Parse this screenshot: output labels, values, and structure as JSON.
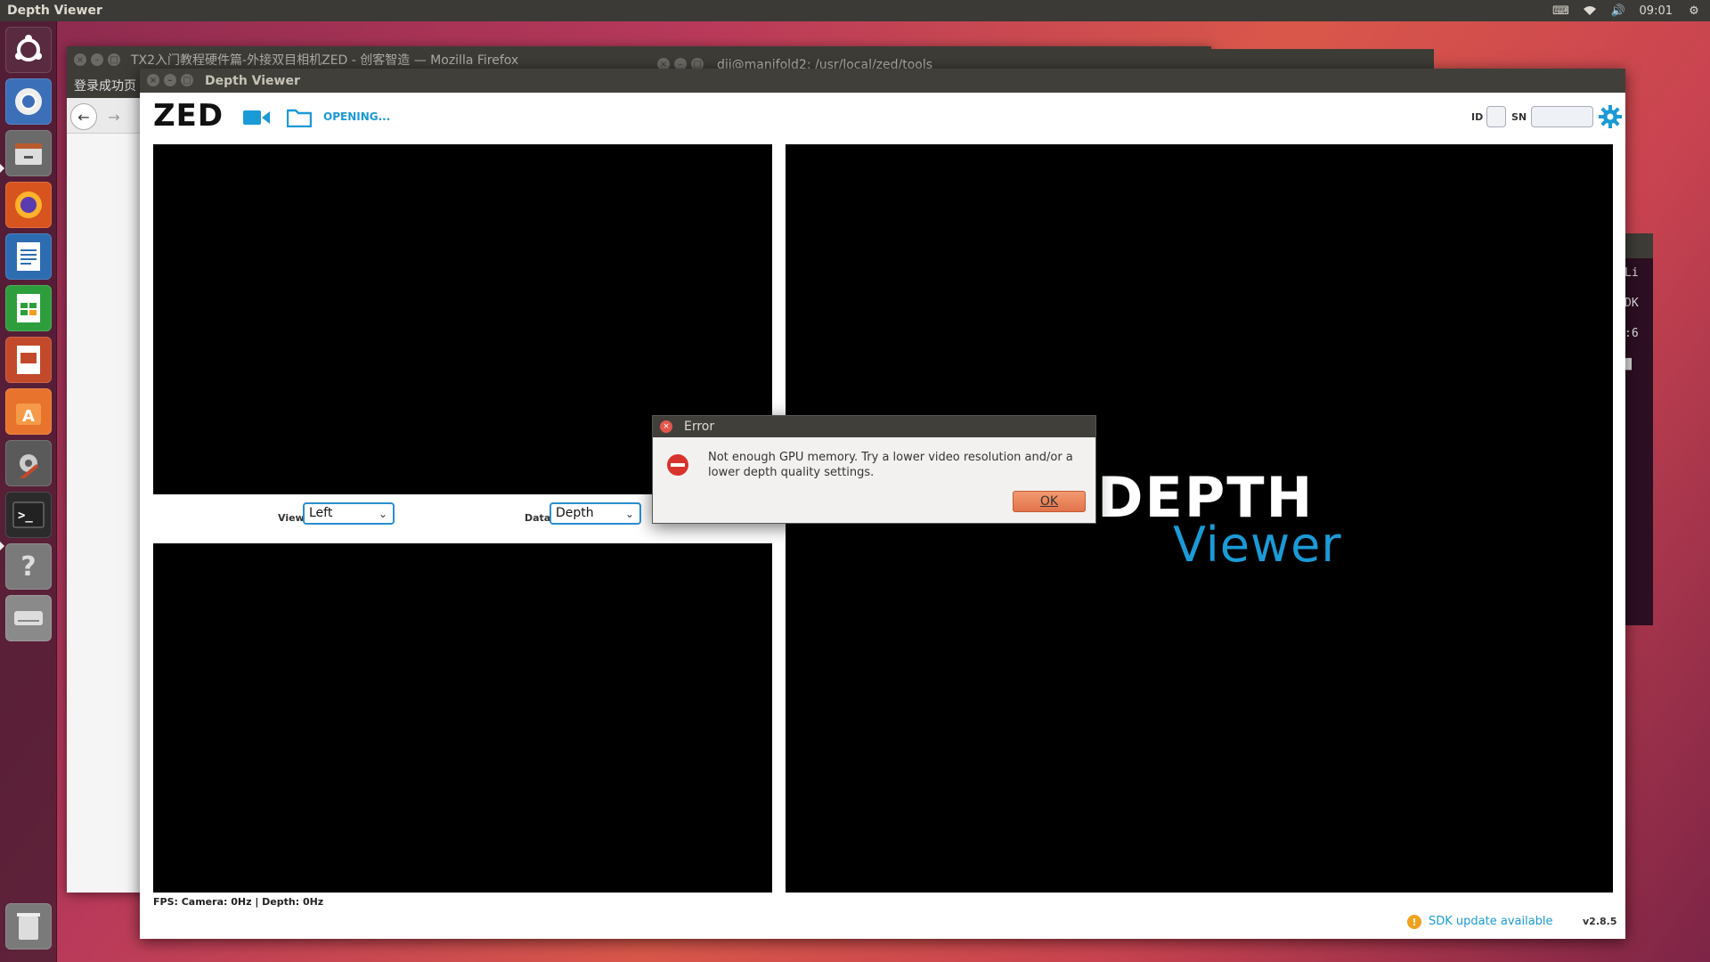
{
  "top_panel": {
    "app_title": "Depth Viewer",
    "clock": "09:01"
  },
  "launcher": {
    "items": [
      {
        "name": "ubuntu-logo",
        "color": "#5a2a40"
      },
      {
        "name": "chromium",
        "color": "#3b6fb8"
      },
      {
        "name": "files",
        "color": "#6a6a6a"
      },
      {
        "name": "firefox",
        "color": "#d7541e"
      },
      {
        "name": "writer",
        "color": "#2d6cb1"
      },
      {
        "name": "calc",
        "color": "#2e9e3d"
      },
      {
        "name": "impress",
        "color": "#c24a2a"
      },
      {
        "name": "software-center",
        "color": "#e8732c"
      },
      {
        "name": "settings",
        "color": "#5a5a5a"
      },
      {
        "name": "terminal",
        "color": "#2b2b2b"
      },
      {
        "name": "help",
        "color": "#7a7a7a"
      },
      {
        "name": "disk",
        "color": "#8a8a8a"
      }
    ],
    "trash": {
      "name": "trash",
      "color": "#7a7a7a"
    }
  },
  "firefox": {
    "title": "TX2入门教程硬件篇-外接双目相机ZED - 创客智造 — Mozilla Firefox",
    "tab_label": "登录成功页"
  },
  "terminal": {
    "title": "dji@manifold2: /usr/local/zed/tools",
    "lines": [
      "Li",
      "DK",
      ":6",
      "▇"
    ]
  },
  "depth_viewer": {
    "title": "Depth Viewer",
    "logo": "ZED",
    "status": "OPENING...",
    "id_label": "ID",
    "sn_label": "SN",
    "view_label": "View",
    "view_value": "Left",
    "data_label": "Data",
    "data_value": "Depth",
    "brand_depth": "DEPTH",
    "brand_viewer": "Viewer",
    "fps": "FPS: Camera: 0Hz | Depth: 0Hz",
    "sdk_update": "SDK update available",
    "version": "v2.8.5",
    "accent_color": "#1a9ad6"
  },
  "dialog": {
    "title": "Error",
    "message": "Not enough GPU memory. Try a lower video resolution and/or a lower depth quality settings.",
    "ok_label": "OK"
  }
}
